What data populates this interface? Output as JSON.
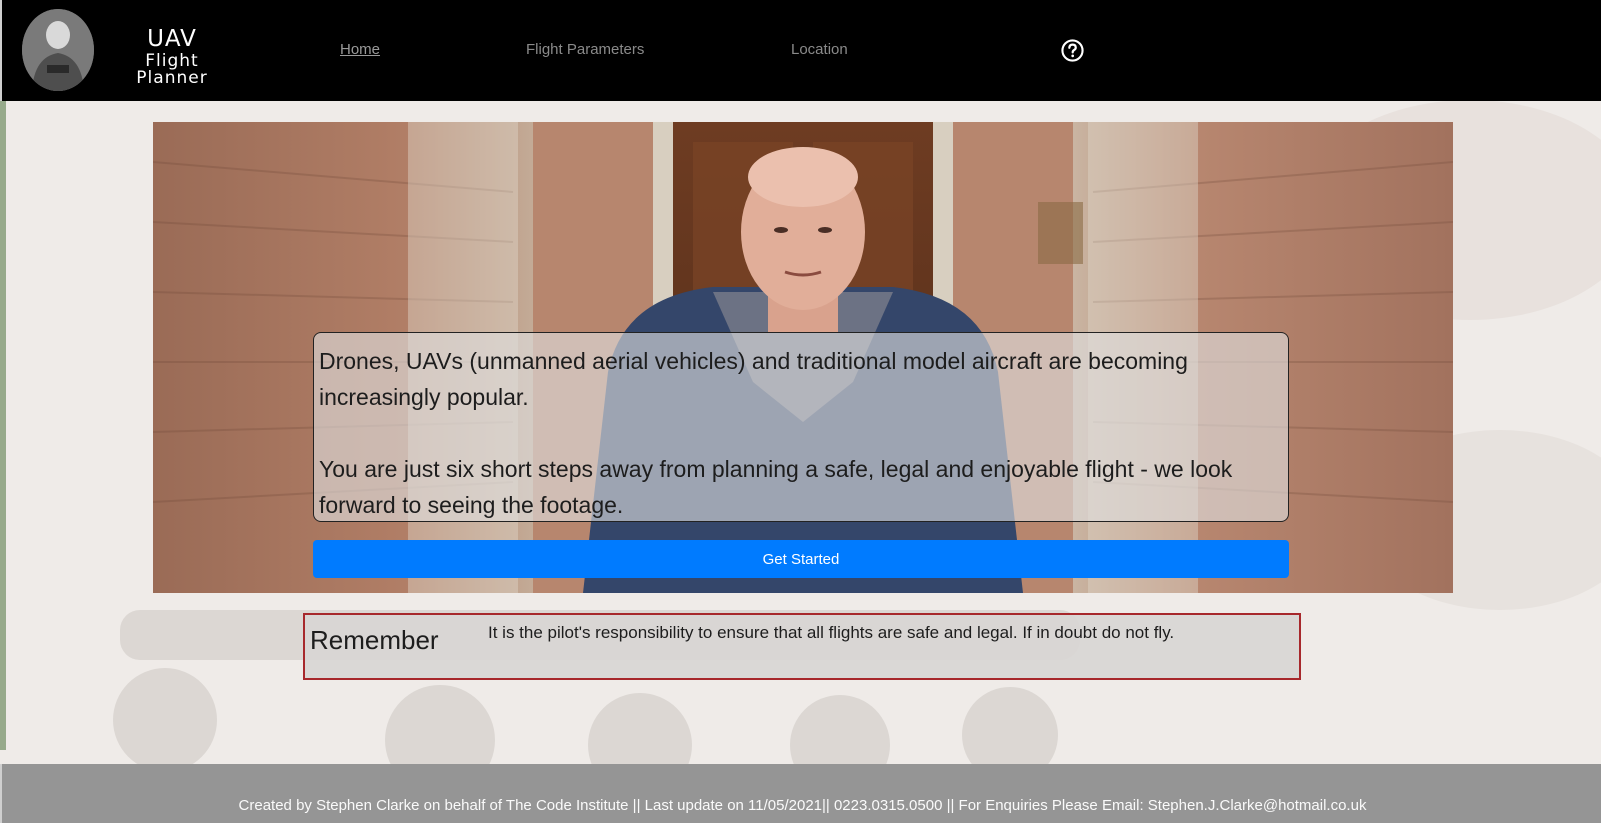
{
  "nav": {
    "logo_line1": "UAV",
    "logo_line2": "Flight Planner",
    "links": [
      {
        "label": "Home",
        "active": true
      },
      {
        "label": "Flight Parameters"
      },
      {
        "label": "Location"
      }
    ],
    "help_icon": "question-circle-icon"
  },
  "hero": {
    "paragraph1": "Drones, UAVs (unmanned aerial vehicles) and traditional model aircraft are becoming increasingly popular.",
    "paragraph2": "You are just six short steps away from planning a safe, legal and enjoyable flight - we look forward to seeing the footage.",
    "button_label": "Get Started"
  },
  "remember": {
    "title": "Remember",
    "text": "It is the pilot's responsibility to ensure that all flights are safe and legal. If in doubt do not fly."
  },
  "footer": {
    "text": "Created by Stephen Clarke on behalf of The Code Institute || Last update on 11/05/2021|| 0223.0315.0500 || For Enquiries Please Email: Stephen.J.Clarke@hotmail.co.uk"
  },
  "colors": {
    "nav_bg": "#000000",
    "accent_button": "#007bff",
    "remember_border": "#a7282c",
    "footer_bg": "#959595"
  }
}
